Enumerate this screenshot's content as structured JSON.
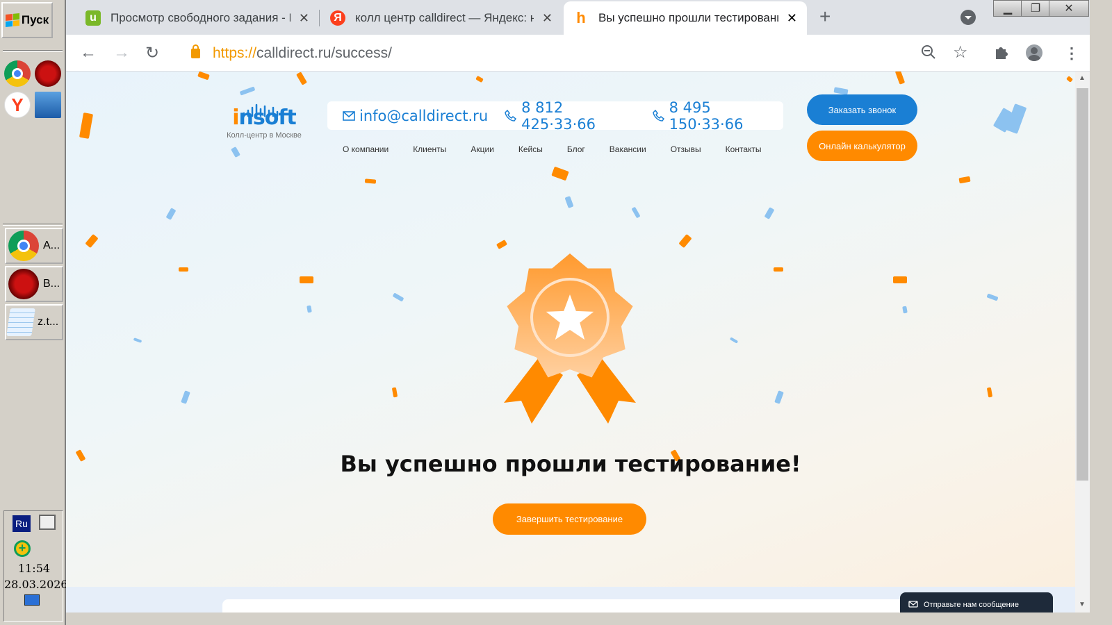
{
  "taskbar": {
    "start_label": "Пуск",
    "tasks": [
      {
        "label": "А...",
        "icon": "chrome-icon"
      },
      {
        "label": "В...",
        "icon": "browser-icon"
      },
      {
        "label": "z.t...",
        "icon": "notepad-icon"
      }
    ],
    "tray": {
      "lang": "Ru",
      "time": "11:54",
      "date": "28.03.2026"
    }
  },
  "browser": {
    "tabs": [
      {
        "title": "Просмотр свободного задания - В",
        "favicon_letter": "u",
        "favicon_color": "#7ab828"
      },
      {
        "title": "колл центр calldirect — Яндекс: на",
        "favicon_letter": "Я",
        "favicon_color": "#fc3f1d"
      },
      {
        "title": "Вы успешно прошли тестирование",
        "favicon_letter": "h",
        "favicon_color": "#ff8a00"
      }
    ],
    "url_scheme": "https://",
    "url_rest": "calldirect.ru/success/"
  },
  "site": {
    "logo_text_pre": "i",
    "logo_text": "nsoft",
    "logo_subtitle": "Колл-центр в Москве",
    "email": "info@calldirect.ru",
    "phone1": "8 812 425·33·66",
    "phone2": "8 495 150·33·66",
    "nav": [
      "О компании",
      "Клиенты",
      "Акции",
      "Кейсы",
      "Блог",
      "Вакансии",
      "Отзывы",
      "Контакты"
    ],
    "btn_call": "Заказать звонок",
    "btn_calc": "Онлайн калькулятор",
    "headline": "Вы успешно прошли тестирование!",
    "finish_button": "Завершить тестирование",
    "chat": "Отправьте нам сообщение"
  },
  "colors": {
    "brand_blue": "#1a7fd4",
    "brand_orange": "#ff8a00"
  }
}
